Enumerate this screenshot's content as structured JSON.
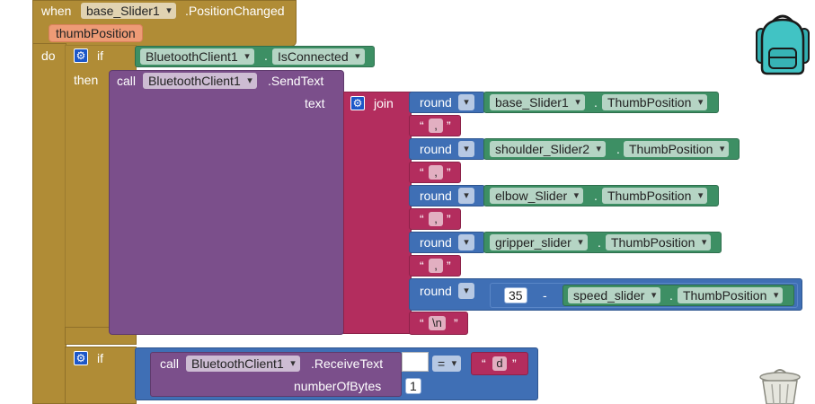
{
  "event": {
    "when": "when",
    "component": "base_Slider1",
    "event_name": ".PositionChanged",
    "param": "thumbPosition",
    "do": "do"
  },
  "if1": {
    "if": "if",
    "then": "then",
    "cond_component": "BluetoothClient1",
    "cond_prop": "IsConnected"
  },
  "sendtext": {
    "call": "call",
    "component": "BluetoothClient1",
    "method": ".SendText",
    "arg": "text"
  },
  "join": {
    "label": "join"
  },
  "rows": [
    {
      "op": "round",
      "component": "base_Slider1",
      "prop": "ThumbPosition"
    },
    {
      "sep": ","
    },
    {
      "op": "round",
      "component": "shoulder_Slider2",
      "prop": "ThumbPosition"
    },
    {
      "sep": ","
    },
    {
      "op": "round",
      "component": "elbow_Slider",
      "prop": "ThumbPosition"
    },
    {
      "sep": ","
    },
    {
      "op": "round",
      "component": "gripper_slider",
      "prop": "ThumbPosition"
    },
    {
      "sep": ","
    }
  ],
  "speed": {
    "op": "round",
    "number": "35",
    "minus": "-",
    "component": "speed_slider",
    "prop": "ThumbPosition"
  },
  "newline": "\\n",
  "quote_open": "“",
  "quote_close": "”",
  "dot": ".",
  "if2": {
    "if": "if",
    "call": "call",
    "component": "BluetoothClient1",
    "method": ".ReceiveText",
    "arg": "numberOfBytes",
    "arg_value": "1",
    "compare": "=",
    "compare_value": "d"
  },
  "icons": [
    "backpack-icon",
    "trash-can-icon",
    "gear-icon",
    "dropdown-arrow-icon"
  ],
  "colors": {
    "event_block": "#b08c36",
    "procedure_block": "#7b4f8b",
    "text_block": "#b32d5e",
    "math_block": "#3f6fb5",
    "component_block": "#3d8f64",
    "param_block": "#ee9b76"
  }
}
